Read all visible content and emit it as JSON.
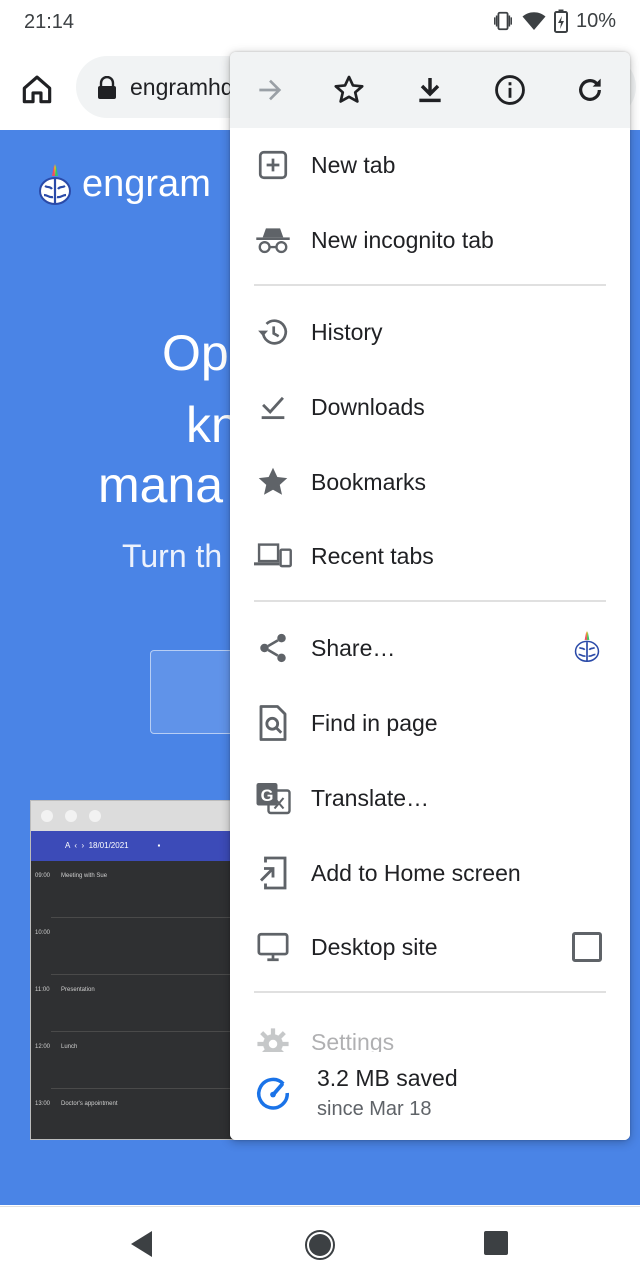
{
  "status_bar": {
    "time": "21:14",
    "battery": "10%"
  },
  "toolbar": {
    "url": "engramhq.xyz"
  },
  "page": {
    "brand": "engram",
    "hero_lines": [
      "Op",
      "kn",
      "mana"
    ],
    "hero_sub": "Turn th",
    "preview": {
      "date": "18/01/2021",
      "events": [
        {
          "time": "09:00",
          "title": "Meeting with Sue"
        },
        {
          "time": "10:00",
          "title": ""
        },
        {
          "time": "11:00",
          "title": "Presentation"
        },
        {
          "time": "12:00",
          "title": "Lunch"
        },
        {
          "time": "13:00",
          "title": "Doctor's appointment"
        }
      ]
    }
  },
  "menu": {
    "items": [
      {
        "label": "New tab",
        "icon": "new-tab-icon"
      },
      {
        "label": "New incognito tab",
        "icon": "incognito-icon"
      },
      {
        "label": "History",
        "icon": "history-icon"
      },
      {
        "label": "Downloads",
        "icon": "download-check-icon"
      },
      {
        "label": "Bookmarks",
        "icon": "star-filled-icon"
      },
      {
        "label": "Recent tabs",
        "icon": "devices-icon"
      },
      {
        "label": "Share…",
        "icon": "share-icon"
      },
      {
        "label": "Find in page",
        "icon": "find-in-page-icon"
      },
      {
        "label": "Translate…",
        "icon": "translate-icon"
      },
      {
        "label": "Add to Home screen",
        "icon": "add-to-home-icon"
      },
      {
        "label": "Desktop site",
        "icon": "desktop-icon"
      },
      {
        "label": "Settings",
        "icon": "gear-icon"
      }
    ],
    "savings_main": "3.2 MB saved",
    "savings_sub": "since Mar 18",
    "desktop_site_checked": false
  },
  "colors": {
    "page_blue": "#4a84e6",
    "accent": "#1a73e8",
    "icon_grey": "#5f6368"
  }
}
